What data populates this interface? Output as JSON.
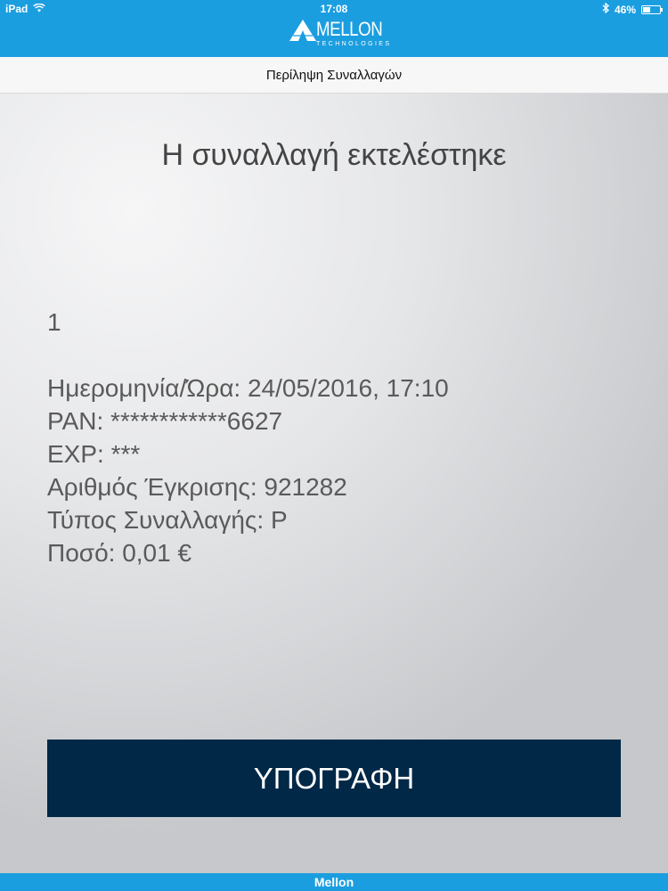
{
  "status_bar": {
    "device": "iPad",
    "time": "17:08",
    "battery": "46%",
    "battery_level": 0.46
  },
  "header": {
    "logo_text": "MELLON",
    "logo_subtext": "TECHNOLOGIES",
    "color": "#1b9ee0"
  },
  "subheader": {
    "title": "Περίληψη Συναλλαγών"
  },
  "main": {
    "title": "Η συναλλαγή εκτελέστηκε",
    "receipt": {
      "number": "1",
      "datetime": "Ημερομηνία/Ώρα: 24/05/2016, 17:10",
      "pan": "PAN: ************6627",
      "exp": "EXP: ***",
      "approval": "Αριθμός Έγκρισης: 921282",
      "type": "Τύπος Συναλλαγής: P",
      "amount": "Ποσό: 0,01 €"
    },
    "sign_button_label": "ΥΠΟΓΡΑΦΗ",
    "button_color": "#012847"
  },
  "footer": {
    "label": "Mellon"
  }
}
